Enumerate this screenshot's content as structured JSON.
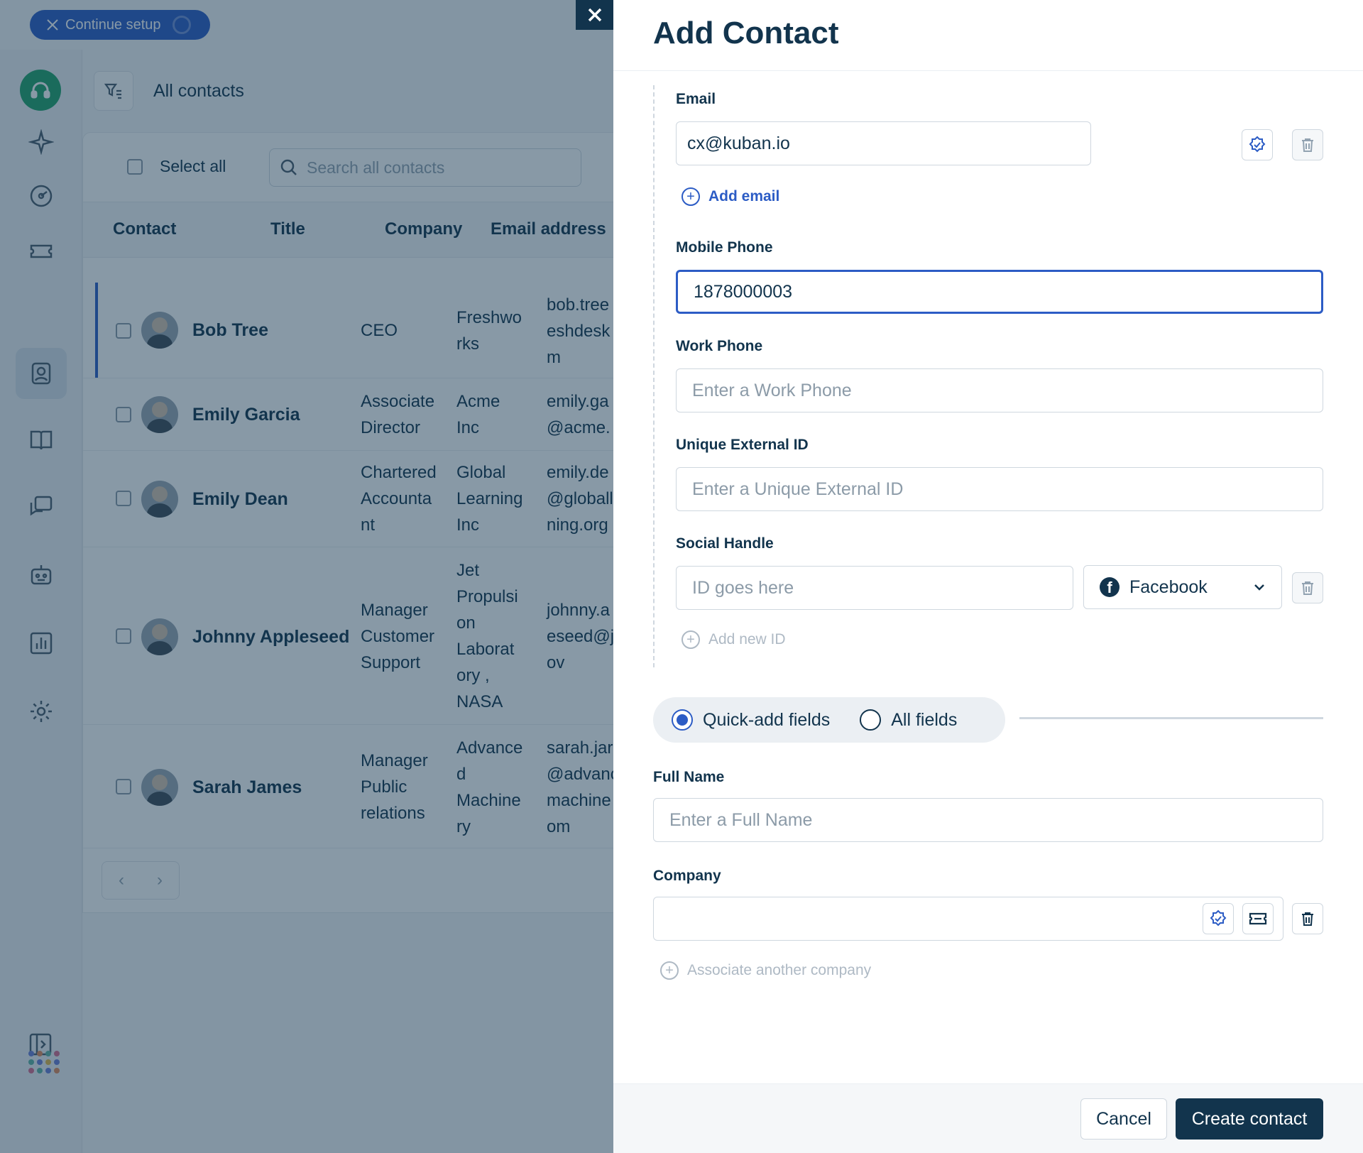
{
  "topbar": {
    "setup_label": "Continue setup"
  },
  "header": {
    "view_title": "All contacts"
  },
  "list": {
    "select_all": "Select all",
    "search_placeholder": "Search all contacts",
    "columns": [
      "Contact",
      "Title",
      "Company",
      "Email address"
    ],
    "rows": [
      {
        "name": "Bob Tree",
        "title": [
          "CEO"
        ],
        "company": [
          "Freshwo",
          "rks"
        ],
        "email": [
          "bob.tree",
          "eshdesk",
          "m"
        ]
      },
      {
        "name": "Emily Garcia",
        "title": [
          "Associate",
          "Director"
        ],
        "company": [
          "Acme",
          "Inc"
        ],
        "email": [
          "emily.ga",
          "@acme."
        ]
      },
      {
        "name": "Emily Dean",
        "title": [
          "Chartered",
          "Accounta",
          "nt"
        ],
        "company": [
          "Global",
          "Learning",
          "Inc"
        ],
        "email": [
          "emily.de",
          "@globall",
          "ning.org"
        ]
      },
      {
        "name": "Johnny Appleseed",
        "title": [
          "Manager",
          "Customer",
          "Support"
        ],
        "company": [
          "Jet",
          "Propulsi",
          "on",
          "Laborat",
          "ory ,",
          "NASA"
        ],
        "email": [
          "johnny.a",
          "eseed@j",
          "ov"
        ]
      },
      {
        "name": "Sarah James",
        "title": [
          "Manager",
          "Public",
          "relations"
        ],
        "company": [
          "Advance",
          "d",
          "Machine",
          "ry"
        ],
        "email": [
          "sarah.jar",
          "@advanc",
          "machine",
          "om"
        ]
      }
    ]
  },
  "drawer": {
    "title": "Add Contact",
    "email": {
      "label": "Email",
      "value": "cx@kuban.io",
      "add_label": "Add email"
    },
    "mobile": {
      "label": "Mobile Phone",
      "value": "1878000003"
    },
    "work": {
      "label": "Work Phone",
      "placeholder": "Enter a Work Phone"
    },
    "external": {
      "label": "Unique External ID",
      "placeholder": "Enter a Unique External ID"
    },
    "social": {
      "label": "Social Handle",
      "placeholder": "ID goes here",
      "platform": "Facebook",
      "add_label": "Add new ID"
    },
    "mode": {
      "quick": "Quick-add fields",
      "all": "All fields",
      "selected": "quick"
    },
    "fullname": {
      "label": "Full Name",
      "placeholder": "Enter a Full Name"
    },
    "company": {
      "label": "Company",
      "value": "",
      "add_label": "Associate another company"
    },
    "cancel": "Cancel",
    "create": "Create contact"
  },
  "colors": {
    "accent": "#2c5cc5",
    "primary_dark": "#12344d",
    "overlay": "#12344d",
    "brand_green": "#23a36b"
  },
  "icons": [
    "tools-icon",
    "headset-logo-icon",
    "sparkle-icon",
    "gauge-icon",
    "ticket-icon",
    "contact-icon",
    "book-icon",
    "chat-icon",
    "bot-icon",
    "chart-icon",
    "gear-icon",
    "expand-icon",
    "apps-icon",
    "close-icon",
    "verify-icon",
    "trash-icon",
    "plus-circle-icon",
    "facebook-icon",
    "chevron-down-icon"
  ]
}
